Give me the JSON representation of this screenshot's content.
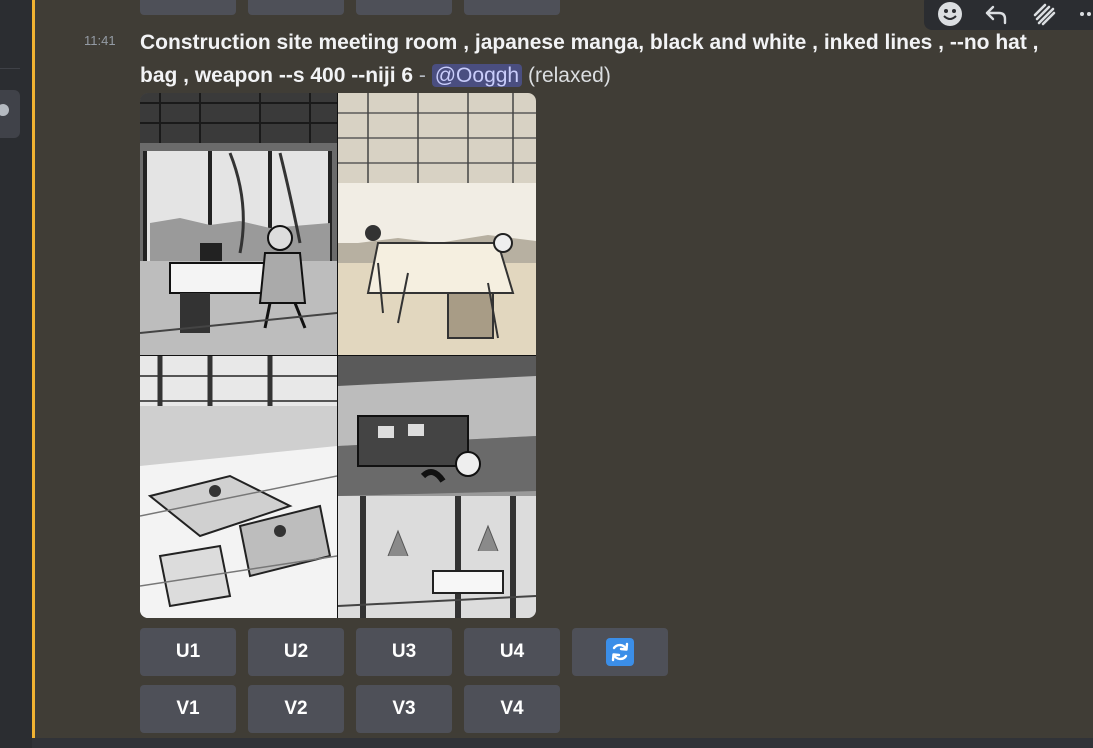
{
  "message": {
    "timestamp": "11:41",
    "prompt": "Construction site meeting room ,   japanese manga, black and white , inked lines , --no hat , bag , weapon --s 400 --niji 6",
    "separator": " - ",
    "mention": "@Ooggh",
    "mode": "(relaxed)"
  },
  "image_grid": {
    "alt": "Construction site meeting room"
  },
  "buttons": {
    "upscale": [
      "U1",
      "U2",
      "U3",
      "U4"
    ],
    "variation": [
      "V1",
      "V2",
      "V3",
      "V4"
    ],
    "reroll_icon": "refresh-icon"
  },
  "toolbar_icons": [
    "emoji-icon",
    "reply-icon",
    "threads-icon",
    "more-icon"
  ],
  "colors": {
    "background": "#403d36",
    "highlight": "#f0b232",
    "button": "#4e5058",
    "mention_bg": "#4a4e80",
    "mention_text": "#c9cdfb",
    "reroll": "#3b8ee8"
  }
}
